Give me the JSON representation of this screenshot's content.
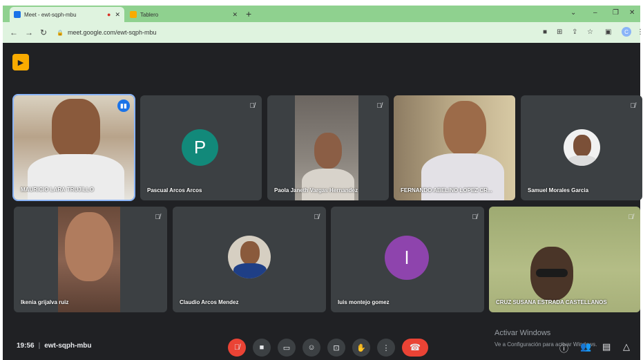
{
  "browser": {
    "tabs": [
      {
        "title": "Meet - ewt-sqph-mbu",
        "active": true,
        "favicon_color": "#1a73e8"
      },
      {
        "title": "Tablero",
        "active": false,
        "favicon_color": "#f9ab00"
      }
    ],
    "url": "meet.google.com/ewt-sqph-mbu",
    "profile_initial": "C"
  },
  "meeting": {
    "time": "19:56",
    "code": "ewt-sqph-mbu"
  },
  "participants": [
    {
      "name": "MAURICIO LARA TRUJILLO",
      "type": "video",
      "speaking": true
    },
    {
      "name": "Pascual Arcos Arcos",
      "type": "avatar",
      "initial": "P",
      "avatar_color": "#12897a",
      "muted": true
    },
    {
      "name": "Paola Janeth Vargas Hernandez",
      "type": "video",
      "muted": true
    },
    {
      "name": "FERNANDO ABELINO LOPEZ CR...",
      "type": "video",
      "muted": false
    },
    {
      "name": "Samuel Morales Garcia",
      "type": "photo",
      "muted": true
    },
    {
      "name": "Ikenia grijalva ruiz",
      "type": "video",
      "muted": true
    },
    {
      "name": "Claudio Arcos Mendez",
      "type": "photo",
      "muted": true
    },
    {
      "name": "luis montejo gomez",
      "type": "avatar",
      "initial": "l",
      "avatar_color": "#8e44ad",
      "muted": true
    },
    {
      "name": "CRUZ SUSANA ESTRADA CASTELLANOS",
      "type": "video",
      "muted": true
    }
  ],
  "watermark": {
    "title": "Activar Windows",
    "subtitle": "Ve a Configuración para activar Windows."
  },
  "colors": {
    "tabbar": "#8fd18f",
    "meet_bg": "#202124",
    "tile_bg": "#3c4043",
    "hangup": "#ea4335"
  }
}
